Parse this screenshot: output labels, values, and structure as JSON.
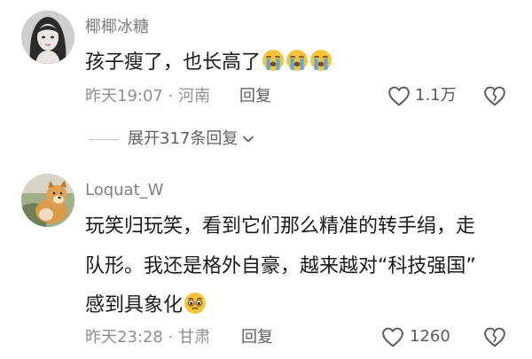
{
  "comments": [
    {
      "username": "椰椰冰糖",
      "lines": [
        "孩子瘦了，也长高了"
      ],
      "emojis": [
        "crying-face",
        "crying-face",
        "crying-face"
      ],
      "time": "昨天19:07",
      "location": "河南",
      "reply_label": "回复",
      "like_count": "1.1万"
    },
    {
      "username": "Loquat_W",
      "lines": [
        "玩笑归玩笑，看到它们那么精准的转手绢，走",
        "队形。我还是格外自豪，越来越对“科技强国”",
        "感到具象化"
      ],
      "emojis": [
        "holding-back-tears-face"
      ],
      "time": "昨天23:28",
      "location": "甘肃",
      "reply_label": "回复",
      "like_count": "1260"
    }
  ],
  "expand_replies": "展开317条回复",
  "separator": "·",
  "colors": {
    "text": "#1a1a1a",
    "meta": "#8f8f8f",
    "emoji": "#f6c33b"
  }
}
